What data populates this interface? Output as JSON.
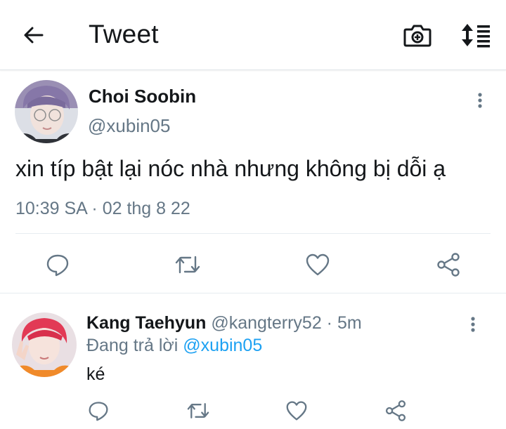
{
  "header": {
    "title": "Tweet",
    "icons": [
      "back-arrow-icon",
      "camera-icon",
      "sort-icon"
    ]
  },
  "main_tweet": {
    "display_name": "Choi Soobin",
    "handle": "@xubin05",
    "text": "xin típ bật lại nóc nhà nhưng không bị dỗi ạ",
    "timestamp": "10:39 SA · 02 thg 8 22",
    "actions": [
      "reply-icon",
      "retweet-icon",
      "like-icon",
      "share-icon"
    ]
  },
  "reply": {
    "display_name": "Kang Taehyun",
    "meta": " @kangterry52 · 5m",
    "replying_prefix": "Đang trả lời ",
    "replying_to": "@xubin05",
    "text": "ké"
  },
  "colors": {
    "text_primary": "#14171a",
    "text_secondary": "#657786",
    "link": "#1da1f2",
    "icon": "#657786"
  }
}
